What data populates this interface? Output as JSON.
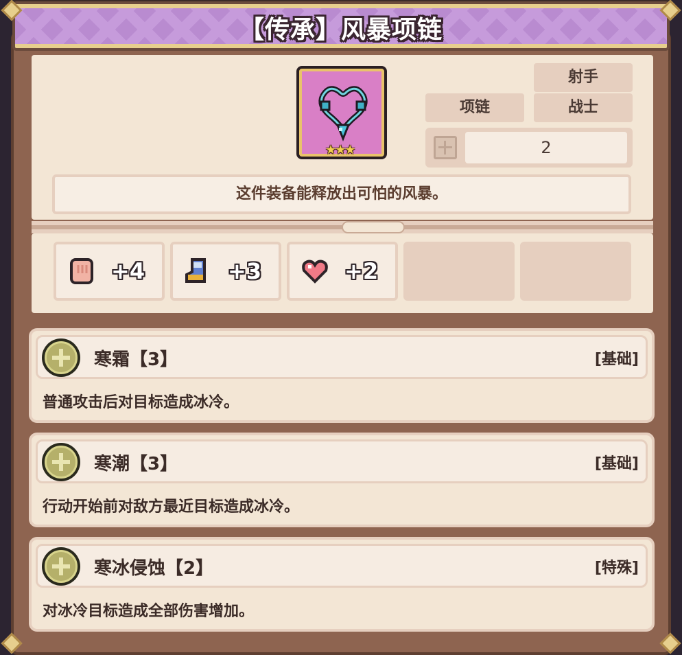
{
  "title": "【传承】风暴项链",
  "item": {
    "icon": "storm-necklace-icon",
    "stars": "★★★",
    "tags": [
      "射手",
      "项链",
      "战士"
    ],
    "slot_count": "2",
    "description": "这件装备能释放出可怕的风暴。"
  },
  "stats": [
    {
      "icon": "fist-icon",
      "value": "+4"
    },
    {
      "icon": "boot-icon",
      "value": "+3"
    },
    {
      "icon": "heart-icon",
      "value": "+2"
    }
  ],
  "skills": [
    {
      "name": "寒霜【3】",
      "type": "[基础]",
      "description": "普通攻击后对目标造成冰冷。"
    },
    {
      "name": "寒潮【3】",
      "type": "[基础]",
      "description": "行动开始前对敌方最近目标造成冰冷。"
    },
    {
      "name": "寒冰侵蚀【2】",
      "type": "[特殊]",
      "description": "对冰冷目标造成全部伤害增加。"
    }
  ],
  "colors": {
    "banner": "#b98bd0",
    "card": "#f3e6d5",
    "frame": "#8e6450",
    "icon_bg": "#d97fc6"
  }
}
